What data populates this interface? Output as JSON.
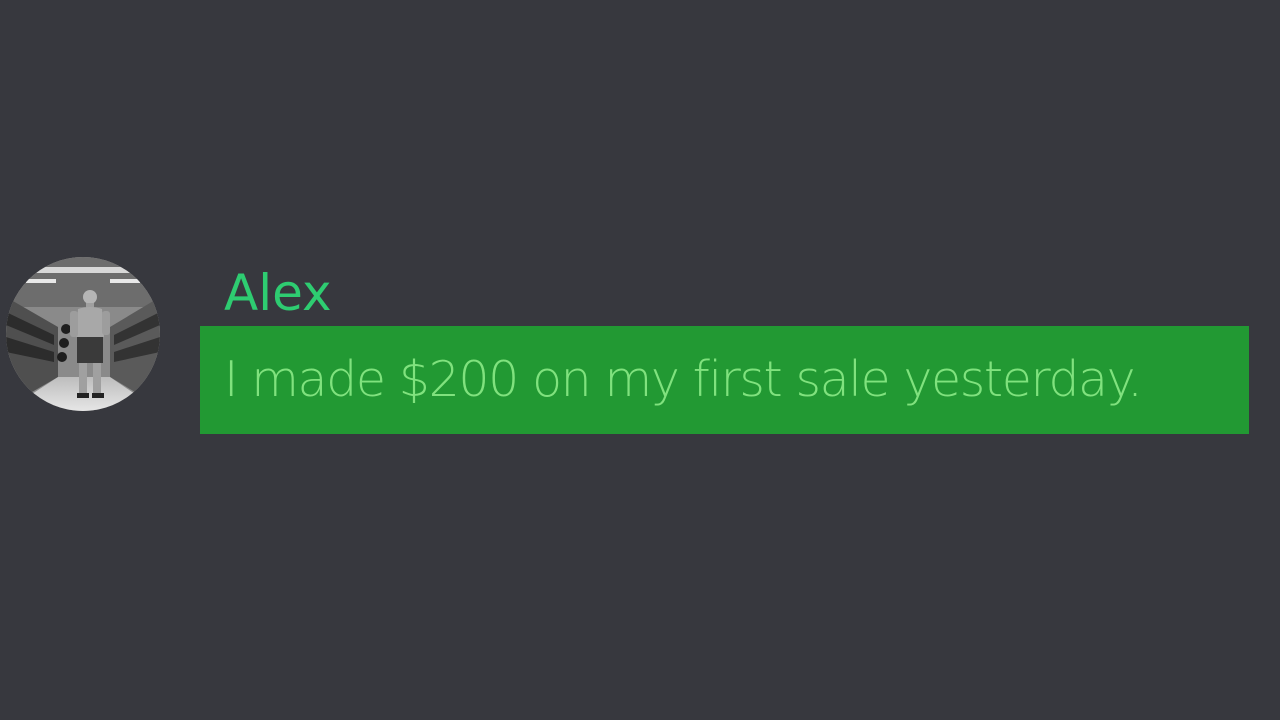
{
  "message": {
    "author": "Alex",
    "text": "I made $200 on my first sale yesterday.",
    "avatar_icon": "user-avatar-photo"
  },
  "colors": {
    "background": "#37383e",
    "username": "#2ecc71",
    "highlight": "#229933",
    "message_text": "#80e27e"
  }
}
